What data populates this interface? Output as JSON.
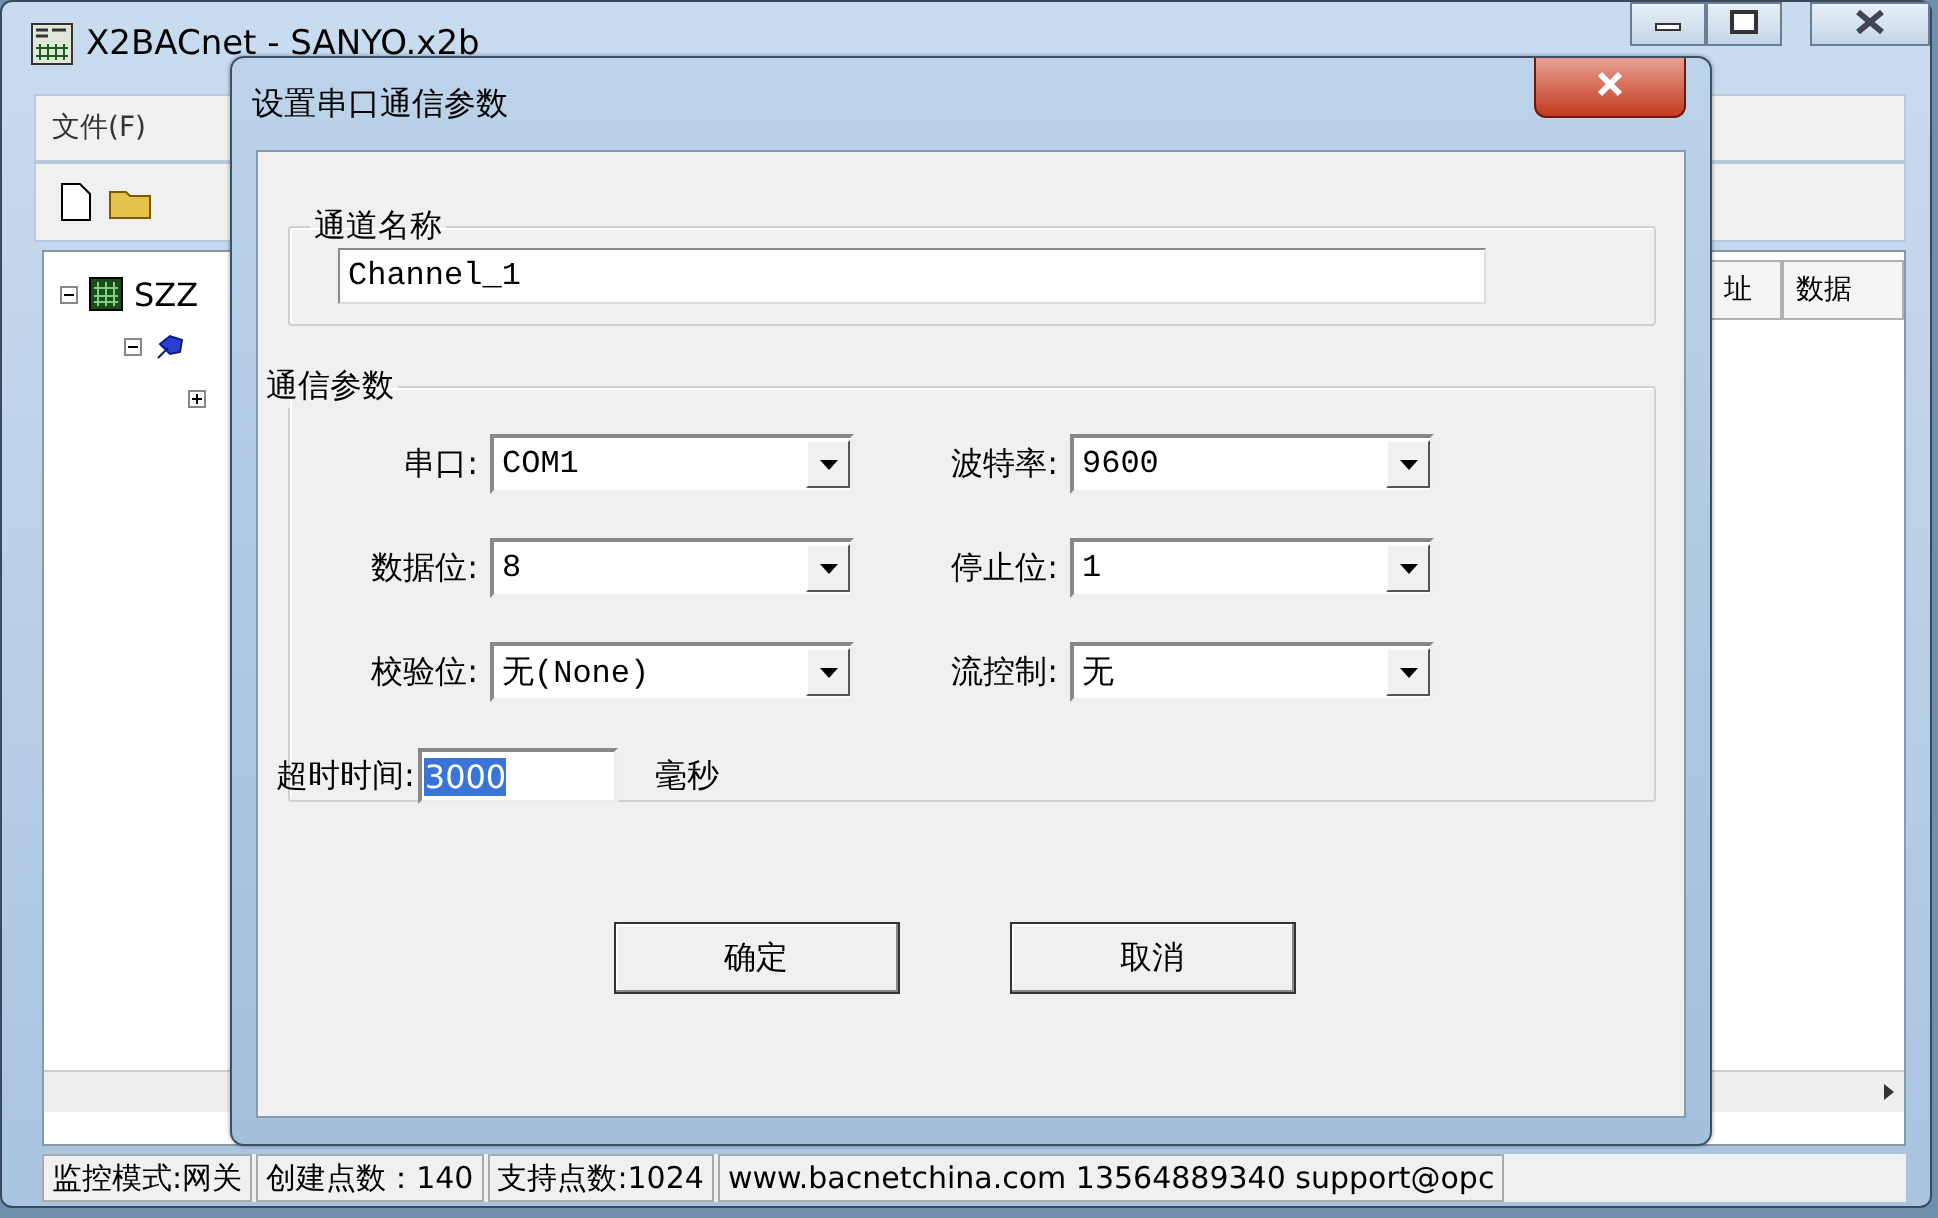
{
  "main_window": {
    "title": "X2BACnet - SANYO.x2b",
    "menu": [
      "文件(F)"
    ],
    "tree": [
      {
        "label": "SZZ",
        "expanded": true,
        "children": [
          {
            "expanded": true,
            "children": [
              {
                "expanded": false
              }
            ]
          }
        ]
      }
    ],
    "table": {
      "columns": [
        "址",
        "数据"
      ]
    },
    "status_bar": [
      "监控模式:网关",
      "创建点数：140",
      "支持点数:1024",
      "www.bacnetchina.com 13564889340 support@opc"
    ]
  },
  "dialog": {
    "title": "设置串口通信参数",
    "channel_name": {
      "label": "通道名称",
      "value": "Channel_1"
    },
    "comm_params": {
      "label": "通信参数",
      "fields": [
        {
          "label": "串口:",
          "value": "COM1"
        },
        {
          "label": "波特率:",
          "value": "9600"
        },
        {
          "label": "数据位:",
          "value": "8"
        },
        {
          "label": "停止位:",
          "value": "1"
        },
        {
          "label": "校验位:",
          "value": "无(None)"
        },
        {
          "label": "流控制:",
          "value": "无"
        }
      ],
      "timeout": {
        "label": "超时时间:",
        "value": "3000",
        "highlighted": true,
        "unit": "毫秒"
      }
    },
    "buttons": [
      "确定",
      "取消"
    ]
  }
}
